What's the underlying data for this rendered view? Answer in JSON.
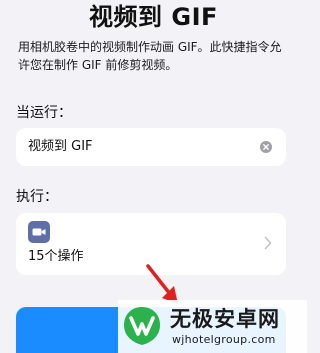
{
  "header": {
    "title": "视频到 GIF",
    "description": "用相机胶卷中的视频制作动画 GIF。此快捷指令允许您在制作 GIF 前修剪视频。"
  },
  "run_section": {
    "label": "当运行：",
    "field_value": "视频到 GIF",
    "clear_icon": "clear-circle-icon"
  },
  "exec_section": {
    "label": "执行：",
    "icon": "video-camera-icon",
    "action_count": "15个操作",
    "chevron_icon": "chevron-right-icon"
  },
  "primary_button": {
    "color": "#1a8cff"
  },
  "annotation": {
    "arrow_color": "#e02020"
  },
  "watermark": {
    "name": "无极安卓网",
    "url": "wjhotelgroup.com"
  },
  "colors": {
    "background": "#f2f2f7",
    "card": "#ffffff",
    "shortcut_icon": "#5e6fa8",
    "accent": "#1a8cff",
    "logo_green": "#2bb24c"
  }
}
